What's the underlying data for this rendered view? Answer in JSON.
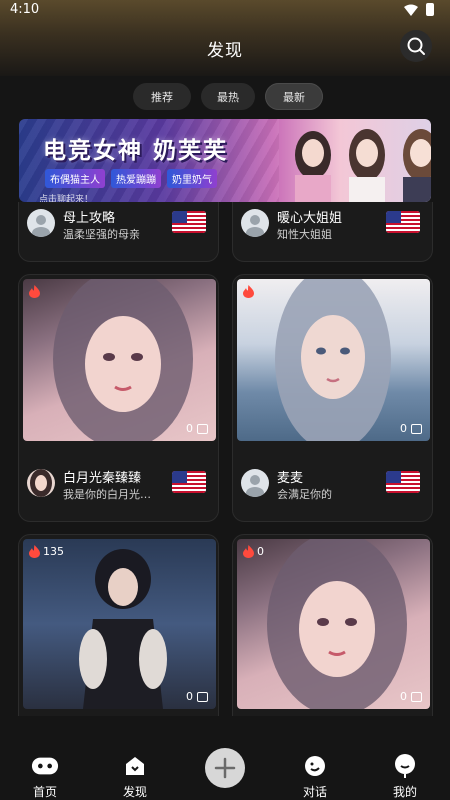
{
  "status_bar": {
    "time": "4:10"
  },
  "header": {
    "title": "发现"
  },
  "tabs": [
    {
      "label": "推荐",
      "active": false
    },
    {
      "label": "最热",
      "active": false
    },
    {
      "label": "最新",
      "active": true
    }
  ],
  "banner": {
    "title": "电竞女神 奶芙芙",
    "tags": [
      "布偶猫主人",
      "热爱蹦蹦",
      "奶里奶气"
    ],
    "footer": "点击聊起来！"
  },
  "cards": [
    {
      "name": "母上攻略",
      "desc": "温柔坚强的母亲",
      "flag": "us-flag"
    },
    {
      "name": "暖心大姐姐",
      "desc": "知性大姐姐",
      "flag": "us-flag"
    },
    {
      "name": "白月光秦臻臻",
      "desc": "我是你的白月光…",
      "likes": "",
      "count": "0",
      "flag": "us-flag"
    },
    {
      "name": "麦麦",
      "desc": "会满足你的",
      "likes": "",
      "count": "0",
      "flag": "us-flag"
    },
    {
      "likes": "135",
      "count": "0"
    },
    {
      "likes": "0",
      "count": "0"
    }
  ],
  "bottom_nav": [
    {
      "label": "首页",
      "icon": "gamepad-icon"
    },
    {
      "label": "发现",
      "icon": "discover-icon"
    },
    {
      "label": "",
      "icon": "plus-icon"
    },
    {
      "label": "对话",
      "icon": "chat-icon"
    },
    {
      "label": "我的",
      "icon": "profile-icon"
    }
  ],
  "colors": {
    "background": "#151515",
    "card": "#1b1b1b",
    "fire": "#ff4a3d"
  }
}
